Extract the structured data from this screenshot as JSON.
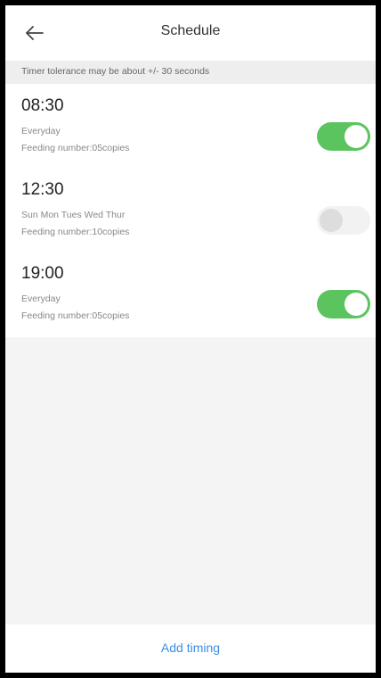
{
  "header": {
    "back_icon": "arrow-left-icon",
    "title": "Schedule"
  },
  "notice": {
    "text": "Timer tolerance may be about +/- 30 seconds"
  },
  "schedules": [
    {
      "time": "08:30",
      "days": "Everyday",
      "feeding": "Feeding number:05copies",
      "enabled": true
    },
    {
      "time": "12:30",
      "days": "Sun Mon Tues Wed Thur",
      "feeding": "Feeding number:10copies",
      "enabled": false
    },
    {
      "time": "19:00",
      "days": "Everyday",
      "feeding": "Feeding number:05copies",
      "enabled": true
    }
  ],
  "footer": {
    "add_label": "Add timing"
  },
  "colors": {
    "toggle_on": "#5cc45f",
    "toggle_off": "#f2f2f2",
    "link": "#3a8ee6"
  }
}
